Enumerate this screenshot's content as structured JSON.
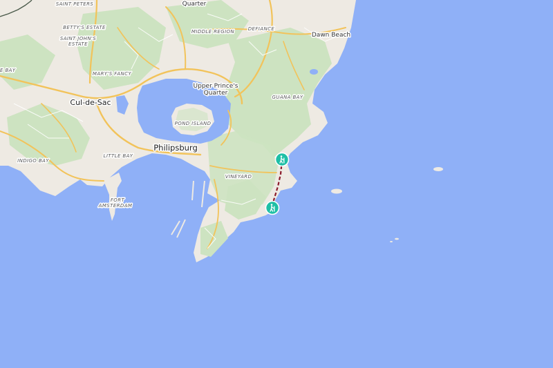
{
  "map": {
    "colors": {
      "sea": "#8fb0f7",
      "land": "#eeeae3",
      "green": "#cde3c1",
      "roads": "#f2c35a",
      "marker": "#1fbfa6",
      "route": "#8b1a2b",
      "boundary": "#4a5a4a"
    },
    "labels": {
      "quarter_top": "Quarter",
      "saint_peters": "SAINT PETERS",
      "bettys_estate": "BETTY'S ESTATE",
      "saint_johns": "SAINT JOHN'S",
      "saint_johns_2": "ESTATE",
      "middle_region": "MIDDLE REGION",
      "defiance": "DEFIANCE",
      "dawn_beach": "Dawn Beach",
      "bay_left": "E BAY",
      "marys_fancy": "MARY'S FANCY",
      "upper_princes": "Upper Prince's",
      "upper_princes_2": "Quarter",
      "guana_bay": "GUANA BAY",
      "cul_de_sac": "Cul-de-Sac",
      "pond_island": "POND ISLAND",
      "philipsburg": "Philipsburg",
      "indigo_bay": "INDIGO BAY",
      "little_bay": "LITTLE BAY",
      "vineyard": "VINEYARD",
      "fort_amsterdam": "FORT",
      "fort_amsterdam_2": "AMSTERDAM"
    },
    "markers": [
      {
        "name": "trailhead-start",
        "icon": "hiking-icon"
      },
      {
        "name": "trailhead-end",
        "icon": "hiking-icon"
      }
    ]
  }
}
